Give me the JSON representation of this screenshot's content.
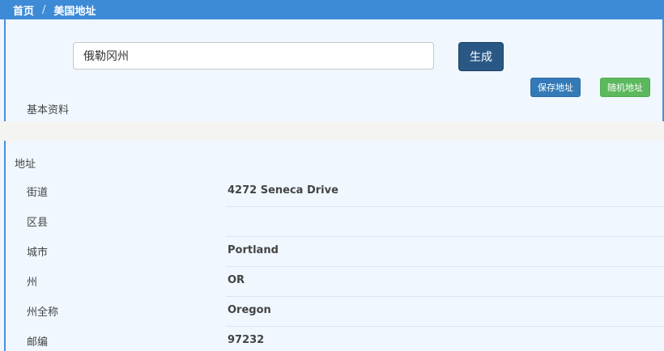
{
  "breadcrumb": {
    "home": "首页",
    "separator": "/",
    "current": "美国地址"
  },
  "search": {
    "value": "俄勒冈州",
    "placeholder": ""
  },
  "buttons": {
    "generate": "生成",
    "save": "保存地址",
    "random": "随机地址"
  },
  "sections": {
    "basic": "基本资料",
    "address": "地址"
  },
  "address_rows": [
    {
      "label": "街道",
      "value": "4272  Seneca Drive"
    },
    {
      "label": "区县",
      "value": ""
    },
    {
      "label": "城市",
      "value": "Portland"
    },
    {
      "label": "州",
      "value": "OR"
    },
    {
      "label": "州全称",
      "value": "Oregon"
    },
    {
      "label": "邮编",
      "value": "97232"
    }
  ],
  "colors": {
    "header": "#3d8ad6",
    "generate_button": "#2a5885",
    "save_button": "#337ab7",
    "random_button": "#5cb85c",
    "background": "#f0f7ff"
  }
}
